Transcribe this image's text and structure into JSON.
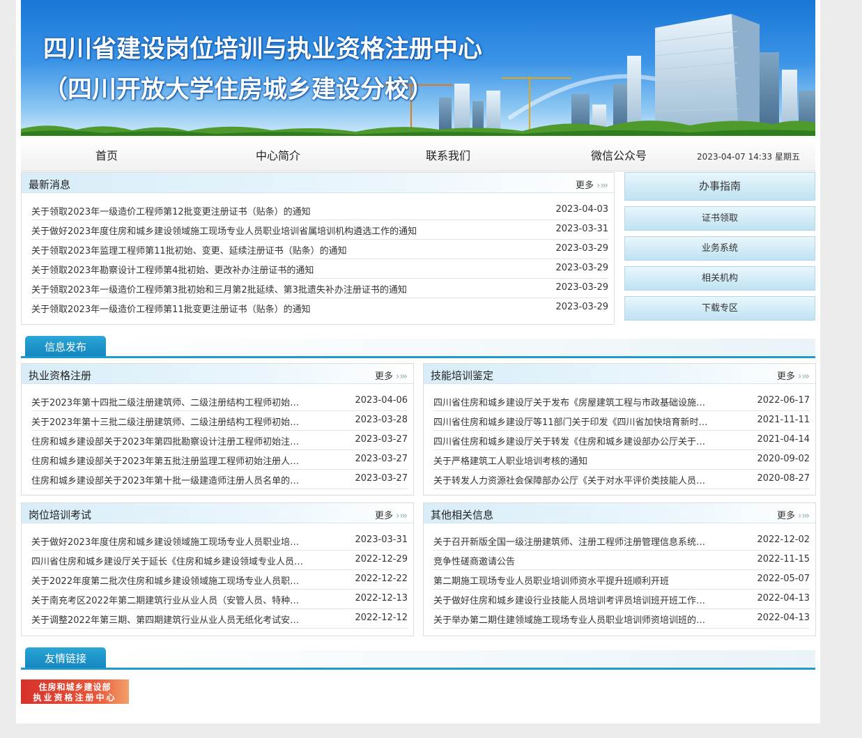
{
  "header": {
    "title_line1": "四川省建设岗位培训与执业资格注册中心",
    "title_line2": "（四川开放大学住房城乡建设分校）"
  },
  "nav": {
    "items": [
      "首页",
      "中心简介",
      "联系我们",
      "微信公众号"
    ],
    "datetime": "2023-04-07 14:33 星期五"
  },
  "news": {
    "title": "最新消息",
    "more": "更多",
    "rows": [
      {
        "text": "关于领取2023年一级造价工程师第12批变更注册证书（贴条）的通知",
        "date": "2023-04-03"
      },
      {
        "text": "关于做好2023年度住房和城乡建设领域施工现场专业人员职业培训省属培训机构遴选工作的通知",
        "date": "2023-03-31"
      },
      {
        "text": "关于领取2023年监理工程师第11批初始、变更、延续注册证书（贴条）的通知",
        "date": "2023-03-29"
      },
      {
        "text": "关于领取2023年勘察设计工程师第4批初始、更改补办注册证书的通知",
        "date": "2023-03-29"
      },
      {
        "text": "关于领取2023年一级造价工程师第3批初始和三月第2批延续、第3批遗失补办注册证书的通知",
        "date": "2023-03-29"
      },
      {
        "text": "关于领取2023年一级造价工程师第11批变更注册证书（贴条）的通知",
        "date": "2023-03-29"
      }
    ]
  },
  "sidebar": {
    "buttons": [
      "办事指南",
      "证书领取",
      "业务系统",
      "相关机构",
      "下载专区"
    ]
  },
  "info_tab": "信息发布",
  "links_tab": "友情链接",
  "sections": [
    {
      "title": "执业资格注册",
      "more": "更多",
      "rows": [
        {
          "text": "关于2023年第十四批二级注册建筑师、二级注册结构工程师初始…",
          "date": "2023-04-06"
        },
        {
          "text": "关于2023年第十三批二级注册建筑师、二级注册结构工程师初始…",
          "date": "2023-03-28"
        },
        {
          "text": "住房和城乡建设部关于2023年第四批勘察设计注册工程师初始注…",
          "date": "2023-03-27"
        },
        {
          "text": "住房和城乡建设部关于2023年第五批注册监理工程师初始注册人…",
          "date": "2023-03-27"
        },
        {
          "text": "住房和城乡建设部关于2023年第十批一级建造师注册人员名单的…",
          "date": "2023-03-27"
        }
      ]
    },
    {
      "title": "技能培训鉴定",
      "more": "更多",
      "rows": [
        {
          "text": "四川省住房和城乡建设厅关于发布《房屋建筑工程与市政基础设施…",
          "date": "2022-06-17"
        },
        {
          "text": "四川省住房和城乡建设厅等11部门关于印发《四川省加快培育新时…",
          "date": "2021-11-11"
        },
        {
          "text": "四川省住房和城乡建设厅关于转发《住房和城乡建设部办公厅关于…",
          "date": "2021-04-14"
        },
        {
          "text": "关于严格建筑工人职业培训考核的通知",
          "date": "2020-09-02"
        },
        {
          "text": "关于转发人力资源社会保障部办公厅《关于对水平评价类技能人员…",
          "date": "2020-08-27"
        }
      ]
    },
    {
      "title": "岗位培训考试",
      "more": "更多",
      "rows": [
        {
          "text": "关于做好2023年度住房和城乡建设领域施工现场专业人员职业培…",
          "date": "2023-03-31"
        },
        {
          "text": "四川省住房和城乡建设厅关于延长《住房和城乡建设领域专业人员…",
          "date": "2022-12-29"
        },
        {
          "text": "关于2022年度第二批次住房和城乡建设领域施工现场专业人员职…",
          "date": "2022-12-22"
        },
        {
          "text": "关于南充考区2022年第二期建筑行业从业人员（安管人员、特种…",
          "date": "2022-12-13"
        },
        {
          "text": "关于调整2022年第三期、第四期建筑行业从业人员无纸化考试安…",
          "date": "2022-12-12"
        }
      ]
    },
    {
      "title": "其他相关信息",
      "more": "更多",
      "rows": [
        {
          "text": "关于召开新版全国一级注册建筑师、注册工程师注册管理信息系统…",
          "date": "2022-12-02"
        },
        {
          "text": "竞争性磋商邀请公告",
          "date": "2022-11-15"
        },
        {
          "text": "第二期施工现场专业人员职业培训师资水平提升班顺利开班",
          "date": "2022-05-07"
        },
        {
          "text": "关于做好住房和城乡建设行业技能人员培训考评员培训班开班工作…",
          "date": "2022-04-13"
        },
        {
          "text": "关于举办第二期住建领域施工现场专业人员职业培训师资培训班的…",
          "date": "2022-04-13"
        }
      ]
    }
  ],
  "friend_link": {
    "line1": "住房和城乡建设部",
    "line2": "执业资格注册中心"
  },
  "colors": {
    "tab_blue": "#1c9acb",
    "head_light_blue": "#d8edf8",
    "banner_blue": "#1a77d6",
    "logo_red": "#d7312a"
  }
}
